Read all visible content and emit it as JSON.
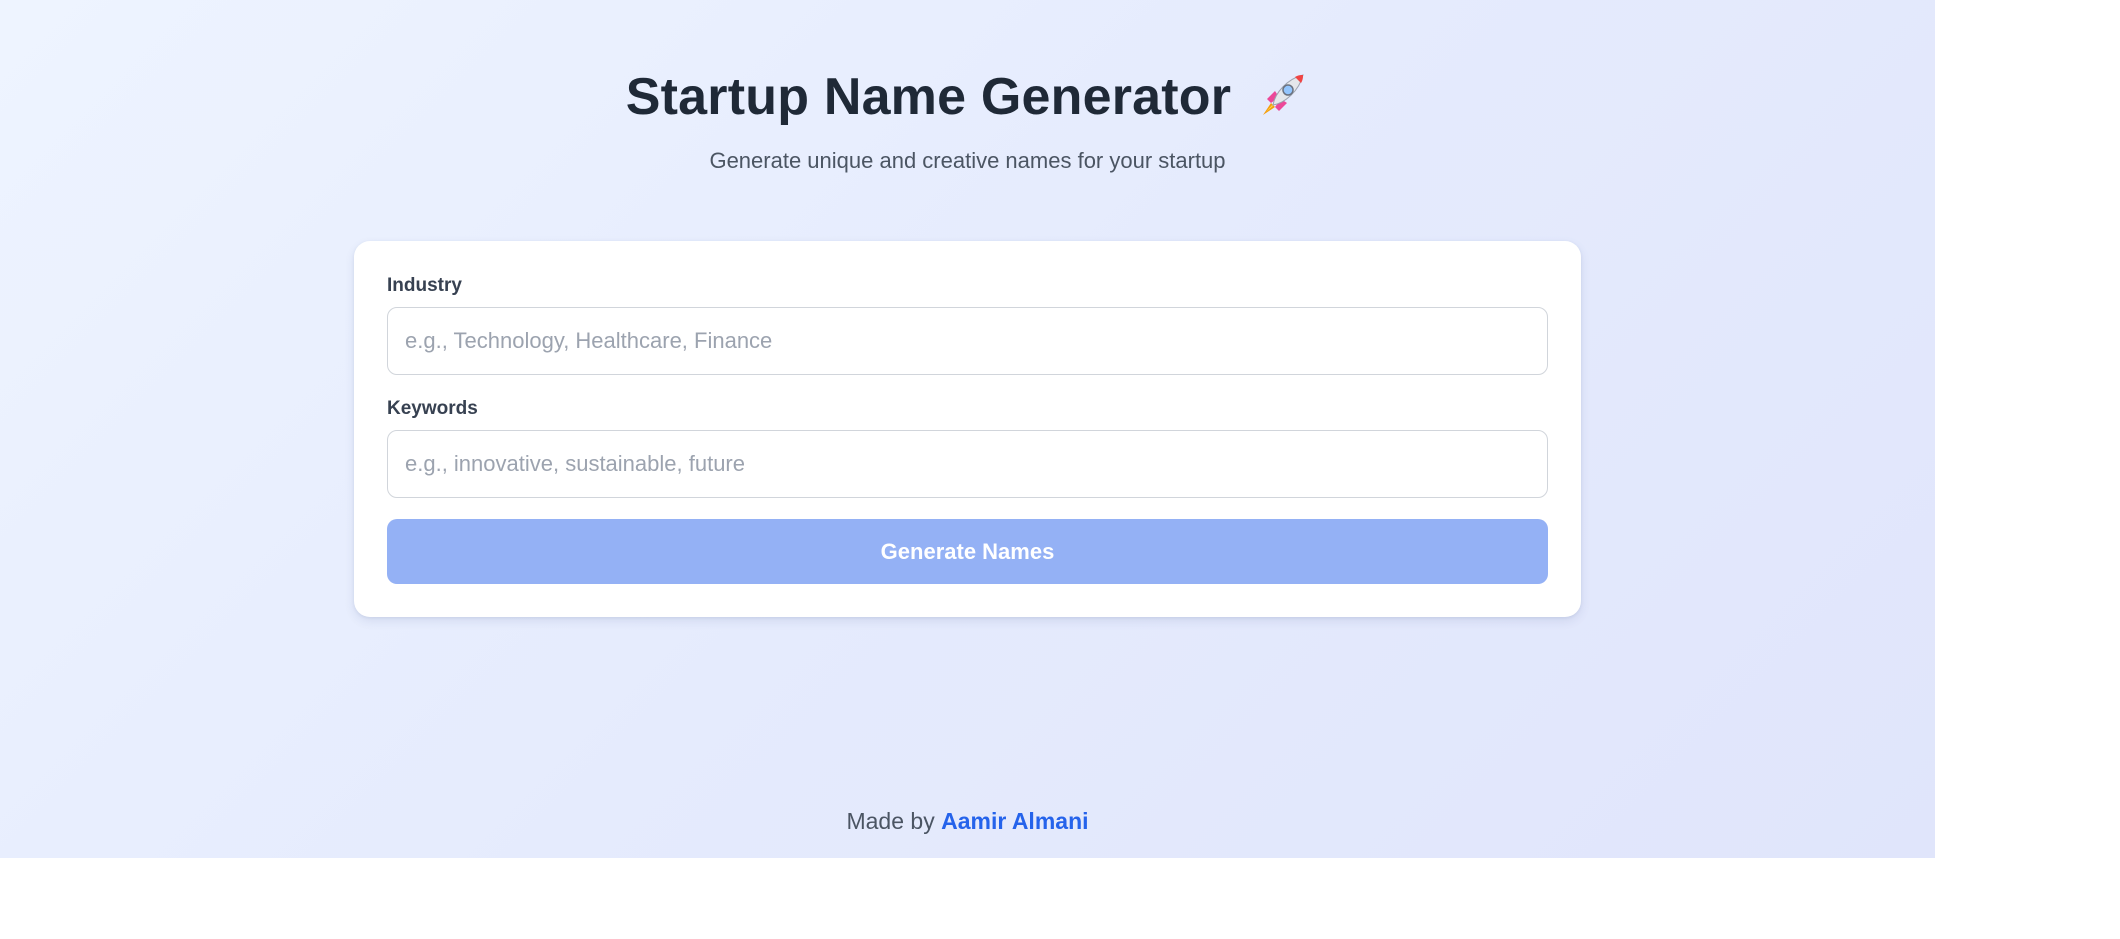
{
  "header": {
    "title": "Startup Name Generator",
    "title_icon": "rocket-icon",
    "subtitle": "Generate unique and creative names for your startup"
  },
  "form": {
    "industry": {
      "label": "Industry",
      "value": "",
      "placeholder": "e.g., Technology, Healthcare, Finance"
    },
    "keywords": {
      "label": "Keywords",
      "value": "",
      "placeholder": "e.g., innovative, sustainable, future"
    },
    "generate_label": "Generate Names"
  },
  "footer": {
    "prefix": "Made by",
    "author": "Aamir Almani"
  },
  "colors": {
    "background_start": "#eef4ff",
    "background_end": "#e0e5fb",
    "title_text": "#1f2937",
    "button_disabled": "#94b1f5",
    "link": "#2563eb"
  }
}
